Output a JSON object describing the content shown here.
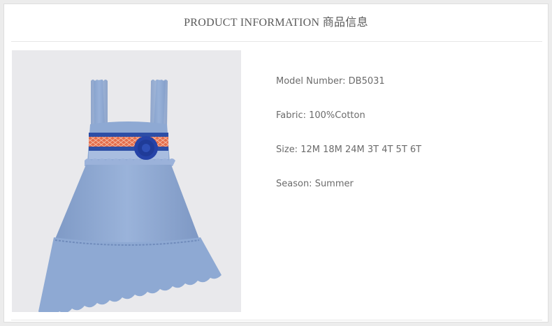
{
  "header": {
    "title": "PRODUCT INFORMATION 商品信息"
  },
  "product": {
    "image_alt": "blue sleeveless ruffle dress",
    "specs": [
      {
        "label": "Model Number",
        "value": "DB5031",
        "text": "Model Number: DB5031"
      },
      {
        "label": "Fabric",
        "value": "100%Cotton",
        "text": "Fabric: 100%Cotton"
      },
      {
        "label": "Size",
        "value": "12M 18M 24M 3T 4T 5T 6T",
        "text": "Size: 12M 18M 24M 3T 4T 5T 6T"
      },
      {
        "label": "Season",
        "value": "Summer",
        "text": "Season: Summer"
      }
    ]
  },
  "colors": {
    "dress_blue": "#8fa9d2",
    "smock_orange": "#e46d4c",
    "smock_navy": "#2d4ea6",
    "flower_blue": "#1f3fa6"
  }
}
